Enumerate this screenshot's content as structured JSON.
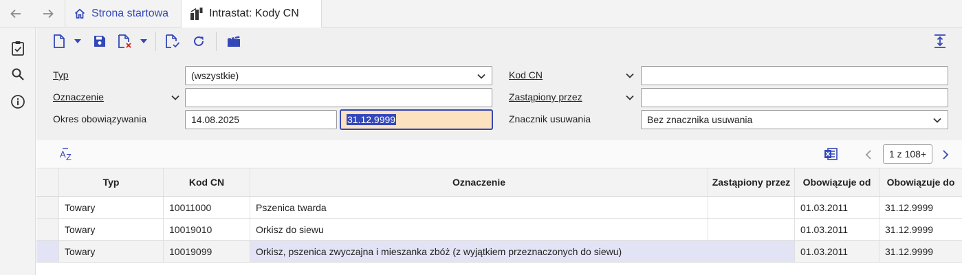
{
  "tabs": {
    "home_label": "Strona startowa",
    "active_label": "Intrastat: Kody CN"
  },
  "filters": {
    "typ": {
      "label": "Typ",
      "value": "(wszystkie)"
    },
    "oznaczenie": {
      "label": "Oznaczenie",
      "value": ""
    },
    "okres": {
      "label": "Okres obowiązywania",
      "from": "14.08.2025",
      "to": "31.12.9999"
    },
    "kod_cn": {
      "label": "Kod CN",
      "value": ""
    },
    "zastapiony": {
      "label": "Zastąpiony przez",
      "value": ""
    },
    "znacznik": {
      "label": "Znacznik usuwania",
      "value": "Bez znacznika usuwania"
    }
  },
  "pager": {
    "text": "1 z 108+"
  },
  "table": {
    "columns": [
      "Typ",
      "Kod CN",
      "Oznaczenie",
      "Zastąpiony przez",
      "Obowiązuje od",
      "Obowiązuje do"
    ],
    "rows": [
      {
        "typ": "Towary",
        "kod": "10011000",
        "oznaczenie": "Pszenica twarda",
        "zastapiony": "",
        "od": "01.03.2011",
        "do": "31.12.9999"
      },
      {
        "typ": "Towary",
        "kod": "10019010",
        "oznaczenie": "Orkisz do siewu",
        "zastapiony": "",
        "od": "01.03.2011",
        "do": "31.12.9999"
      },
      {
        "typ": "Towary",
        "kod": "10019099",
        "oznaczenie": "Orkisz, pszenica zwyczajna i mieszanka zbóż (z wyjątkiem przeznaczonych do siewu)",
        "zastapiony": "",
        "od": "01.03.2011",
        "do": "31.12.9999"
      }
    ]
  },
  "icons": {
    "accent": "#3347b8",
    "rail": [
      "clipboard-check-icon",
      "search-icon",
      "info-icon"
    ],
    "toolbar": [
      "new-document-icon",
      "save-icon",
      "delete-document-icon",
      "validate-document-icon",
      "refresh-icon",
      "clapperboard-icon",
      "expand-vertical-icon"
    ]
  }
}
